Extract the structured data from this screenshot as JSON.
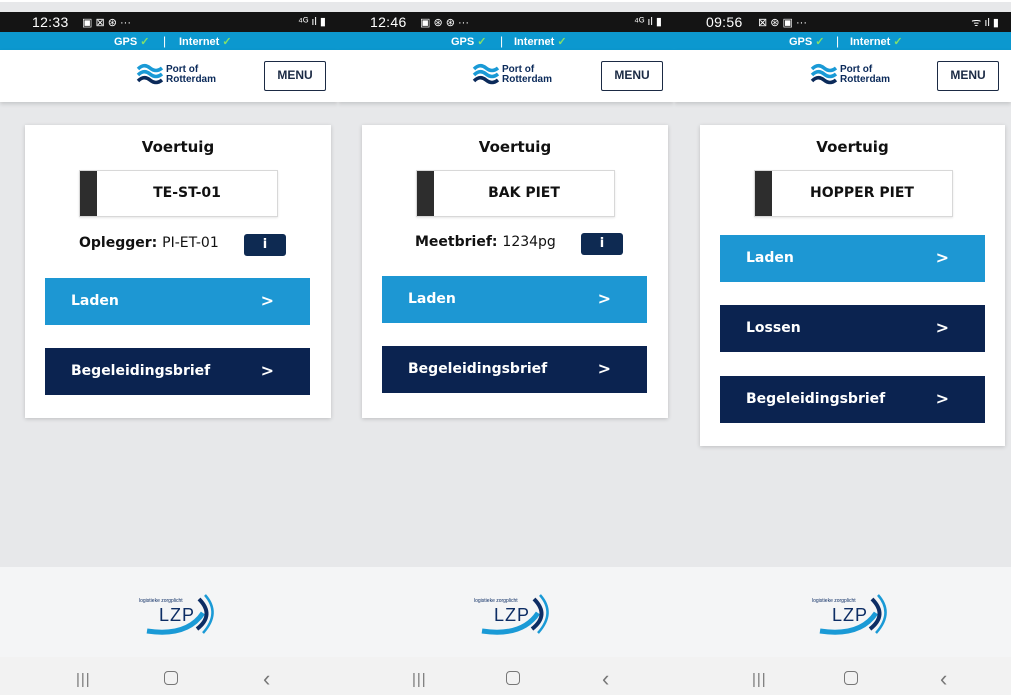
{
  "header": {
    "gps_label": "GPS",
    "check_mark": "✓",
    "internet_label": "Internet",
    "separator": "|",
    "logo_text": "Port of Rotterdam",
    "menu_label": "MENU"
  },
  "footer": {
    "logo_text": "LZP",
    "logo_tagline": "logistieke zorgplicht"
  },
  "colors": {
    "accent_blue": "#1d97d3",
    "dark_navy": "#0b2350",
    "connection_bar": "#0c98cf",
    "status_ok": "#84e06a"
  },
  "screens": [
    {
      "time": "12:33",
      "card_title": "Voertuig",
      "vehicle": "TE-ST-01",
      "info_key": "Oplegger:",
      "info_value": "PI-ET-01",
      "info_button": "i",
      "actions": [
        "Laden",
        "Begeleidingsbrief"
      ]
    },
    {
      "time": "12:46",
      "card_title": "Voertuig",
      "vehicle": "BAK PIET",
      "info_key": "Meetbrief:",
      "info_value": "1234pg",
      "info_button": "i",
      "actions": [
        "Laden",
        "Begeleidingsbrief"
      ]
    },
    {
      "time": "09:56",
      "card_title": "Voertuig",
      "vehicle": "HOPPER PIET",
      "actions": [
        "Laden",
        "Lossen",
        "Begeleidingsbrief"
      ]
    }
  ]
}
